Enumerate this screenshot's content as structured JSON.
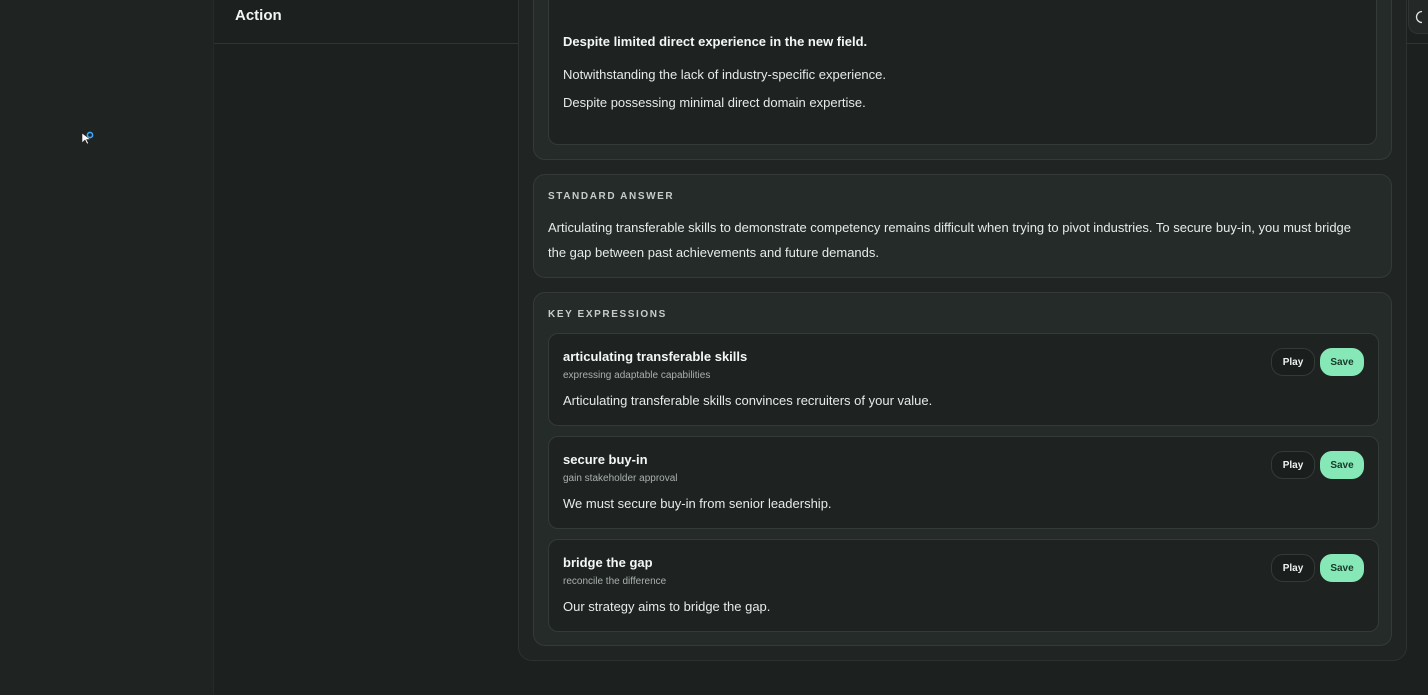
{
  "header": {
    "title": "Action"
  },
  "top_icons": [
    "inbox-icon",
    "bell-icon",
    "moon-icon"
  ],
  "alternatives": [
    "Despite limited direct experience in the new field.",
    "Notwithstanding the lack of industry-specific experience.",
    "Despite possessing minimal direct domain expertise."
  ],
  "standard": {
    "label": "STANDARD ANSWER",
    "text": "Articulating transferable skills to demonstrate competency remains difficult when trying to pivot industries. To secure buy-in, you must bridge the gap between past achievements and future demands."
  },
  "key_expressions": {
    "label": "KEY EXPRESSIONS",
    "play_label": "Play",
    "save_label": "Save",
    "items": [
      {
        "phrase": "articulating transferable skills",
        "meaning": "expressing adaptable capabilities",
        "example": "Articulating transferable skills convinces recruiters of your value."
      },
      {
        "phrase": "secure buy-in",
        "meaning": "gain stakeholder approval",
        "example": "We must secure buy-in from senior leadership."
      },
      {
        "phrase": "bridge the gap",
        "meaning": "reconcile the difference",
        "example": "Our strategy aims to bridge the gap."
      }
    ]
  },
  "colors": {
    "accent": "#86e8b7",
    "background": "#1c201f",
    "card": "#252b29"
  }
}
